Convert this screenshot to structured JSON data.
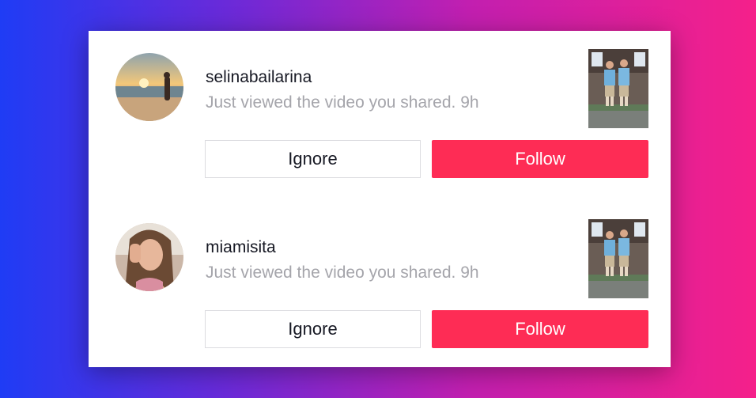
{
  "colors": {
    "follow_button": "#fe2c55",
    "ignore_border": "#dcdce0",
    "username_text": "#161823",
    "message_text": "#a5a5ab"
  },
  "notifications": [
    {
      "username": "selinabailarina",
      "message": "Just viewed the video you shared. 9h",
      "avatar_icon": "beach-photo",
      "thumbnail_icon": "video-thumbnail",
      "ignore_label": "Ignore",
      "follow_label": "Follow"
    },
    {
      "username": "miamisita",
      "message": "Just viewed the video you shared. 9h",
      "avatar_icon": "selfie-photo",
      "thumbnail_icon": "video-thumbnail",
      "ignore_label": "Ignore",
      "follow_label": "Follow"
    }
  ]
}
